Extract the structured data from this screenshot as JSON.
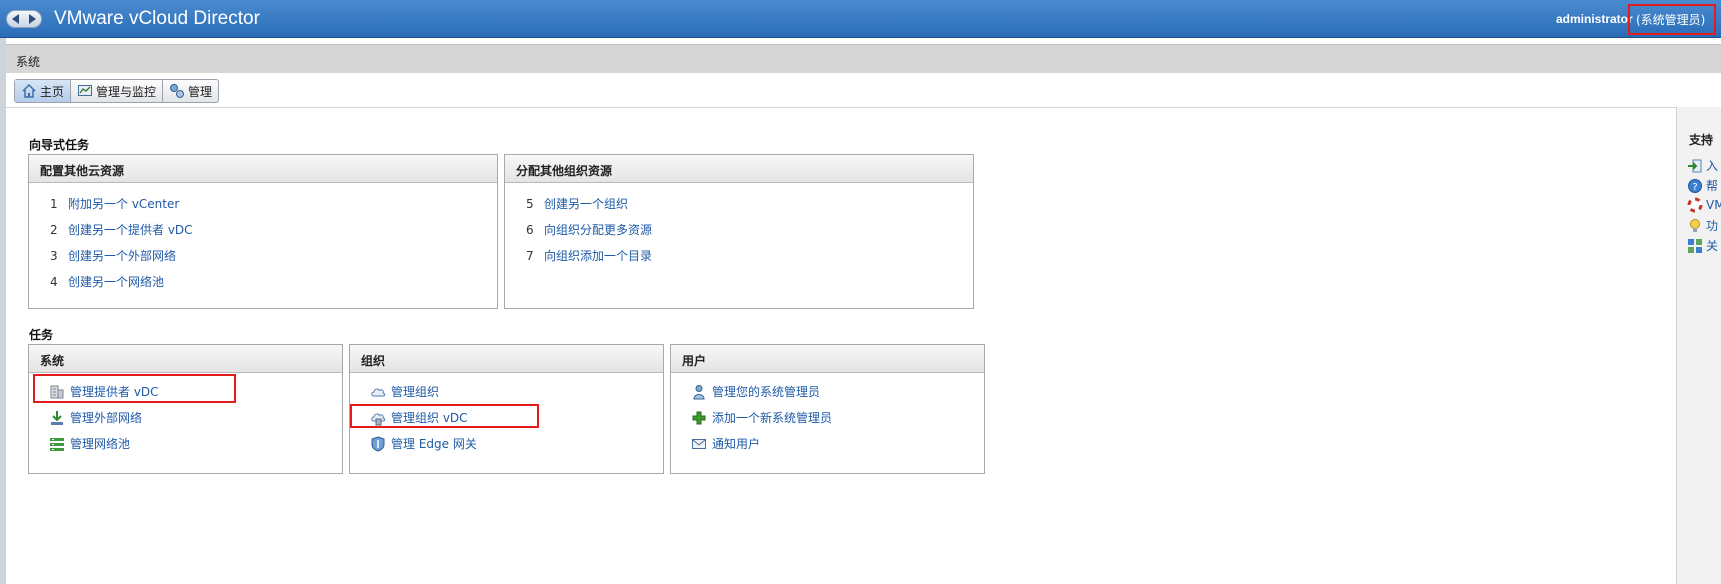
{
  "header": {
    "app_title": "VMware vCloud Director",
    "user_name": "administrator",
    "user_role": "(系统管理员)"
  },
  "breadcrumb": {
    "label": "系统"
  },
  "tabs": [
    {
      "label": "主页",
      "icon": "home-icon",
      "active": true
    },
    {
      "label": "管理与监控",
      "icon": "monitor-icon",
      "active": false
    },
    {
      "label": "管理",
      "icon": "manage-icon",
      "active": false
    }
  ],
  "wizard": {
    "title": "向导式任务",
    "panels": [
      {
        "title": "配置其他云资源",
        "items": [
          {
            "num": "1",
            "label": "附加另一个 vCenter"
          },
          {
            "num": "2",
            "label": "创建另一个提供者 vDC"
          },
          {
            "num": "3",
            "label": "创建另一个外部网络"
          },
          {
            "num": "4",
            "label": "创建另一个网络池"
          }
        ]
      },
      {
        "title": "分配其他组织资源",
        "items": [
          {
            "num": "5",
            "label": "创建另一个组织"
          },
          {
            "num": "6",
            "label": "向组织分配更多资源"
          },
          {
            "num": "7",
            "label": "向组织添加一个目录"
          }
        ]
      }
    ]
  },
  "tasks": {
    "title": "任务",
    "panels": [
      {
        "title": "系统",
        "items": [
          {
            "label": "管理提供者 vDC",
            "icon": "provider-vdc-icon"
          },
          {
            "label": "管理外部网络",
            "icon": "external-network-icon"
          },
          {
            "label": "管理网络池",
            "icon": "network-pool-icon"
          }
        ]
      },
      {
        "title": "组织",
        "items": [
          {
            "label": "管理组织",
            "icon": "cloud-icon"
          },
          {
            "label": "管理组织 vDC",
            "icon": "org-vdc-icon"
          },
          {
            "label": "管理 Edge 网关",
            "icon": "shield-icon"
          }
        ]
      },
      {
        "title": "用户",
        "items": [
          {
            "label": "管理您的系统管理员",
            "icon": "user-icon"
          },
          {
            "label": "添加一个新系统管理员",
            "icon": "plus-icon"
          },
          {
            "label": "通知用户",
            "icon": "mail-icon"
          }
        ]
      }
    ]
  },
  "support": {
    "title": "支持",
    "items": [
      {
        "label": "入",
        "icon": "enter-icon"
      },
      {
        "label": "帮",
        "icon": "help-icon"
      },
      {
        "label": "VM",
        "icon": "lifebuoy-icon"
      },
      {
        "label": "功",
        "icon": "bulb-icon"
      },
      {
        "label": "关",
        "icon": "about-icon"
      }
    ]
  },
  "colors": {
    "header_blue": "#2a6db7",
    "link_blue": "#1f5aa6",
    "highlight_red": "#e41b1b"
  }
}
